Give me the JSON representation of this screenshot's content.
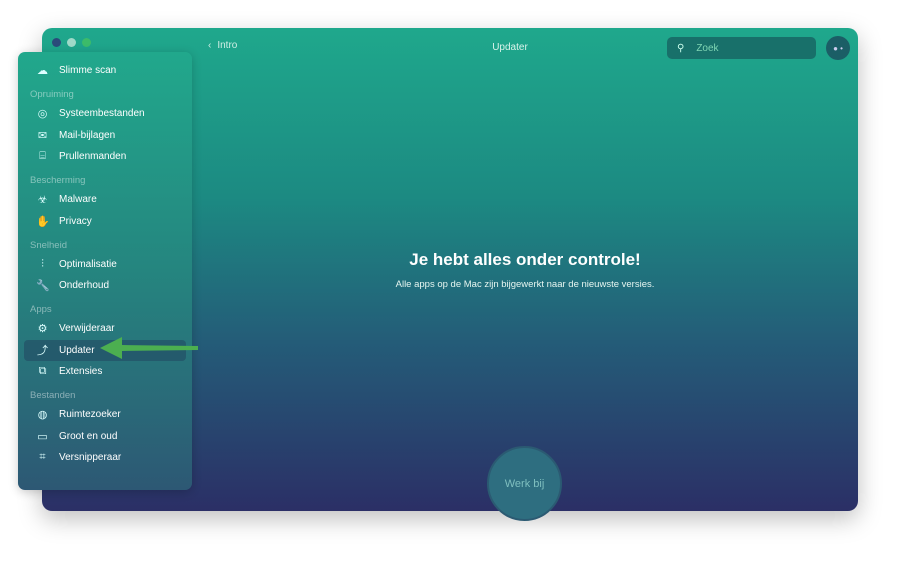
{
  "window": {
    "title": "Updater",
    "back_label": "Intro",
    "search_placeholder": "Zoek"
  },
  "sidebar": {
    "items": [
      {
        "type": "item",
        "label": "Slimme scan",
        "icon": "smart-scan-icon",
        "glyph": "☁"
      },
      {
        "type": "section",
        "label": "Opruiming"
      },
      {
        "type": "item",
        "label": "Systeembestanden",
        "icon": "system-files-icon",
        "glyph": "◎"
      },
      {
        "type": "item",
        "label": "Mail-bijlagen",
        "icon": "mail-icon",
        "glyph": "✉"
      },
      {
        "type": "item",
        "label": "Prullenmanden",
        "icon": "trash-icon",
        "glyph": "⌸"
      },
      {
        "type": "section",
        "label": "Bescherming"
      },
      {
        "type": "item",
        "label": "Malware",
        "icon": "biohazard-icon",
        "glyph": "☣"
      },
      {
        "type": "item",
        "label": "Privacy",
        "icon": "hand-icon",
        "glyph": "✋"
      },
      {
        "type": "section",
        "label": "Snelheid"
      },
      {
        "type": "item",
        "label": "Optimalisatie",
        "icon": "sliders-icon",
        "glyph": "⫶"
      },
      {
        "type": "item",
        "label": "Onderhoud",
        "icon": "wrench-icon",
        "glyph": "🔧"
      },
      {
        "type": "section",
        "label": "Apps"
      },
      {
        "type": "item",
        "label": "Verwijderaar",
        "icon": "uninstaller-icon",
        "glyph": "⚙"
      },
      {
        "type": "item",
        "label": "Updater",
        "icon": "updater-icon",
        "glyph": "⤴",
        "selected": true
      },
      {
        "type": "item",
        "label": "Extensies",
        "icon": "extensions-icon",
        "glyph": "⧉"
      },
      {
        "type": "section",
        "label": "Bestanden"
      },
      {
        "type": "item",
        "label": "Ruimtezoeker",
        "icon": "space-lens-icon",
        "glyph": "◍"
      },
      {
        "type": "item",
        "label": "Groot en oud",
        "icon": "folder-icon",
        "glyph": "▭"
      },
      {
        "type": "item",
        "label": "Versnipperaar",
        "icon": "shredder-icon",
        "glyph": "⌗"
      }
    ]
  },
  "main": {
    "heading": "Je hebt alles onder controle!",
    "message": "Alle apps op de Mac zijn bijgewerkt naar de nieuwste versies.",
    "update_button": "Werk bij"
  },
  "colors": {
    "arrow": "#4caf50",
    "selected": "#2a4f6a"
  }
}
